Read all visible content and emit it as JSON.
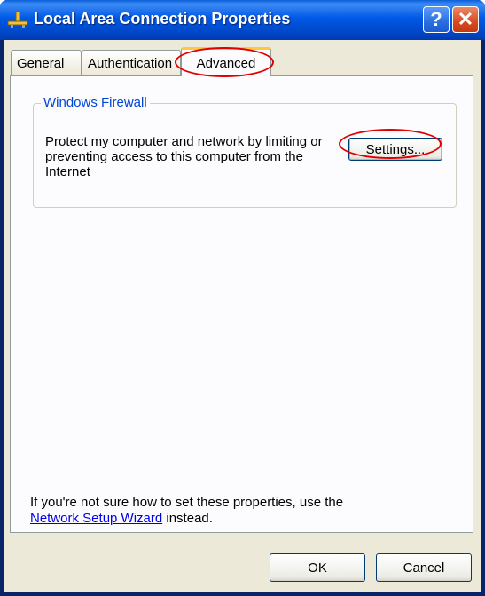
{
  "window": {
    "title": "Local Area Connection Properties",
    "help_glyph": "?",
    "close_glyph": "✕",
    "icon": "network-connection-icon"
  },
  "tabs": [
    {
      "label": "General",
      "selected": false
    },
    {
      "label": "Authentication",
      "selected": false
    },
    {
      "label": "Advanced",
      "selected": true
    }
  ],
  "firewall": {
    "group_label": "Windows Firewall",
    "description": "Protect my computer and network by limiting or preventing access to this computer from the Internet",
    "settings_label_prefix": "",
    "settings_label_underlined": "S",
    "settings_label_rest": "ettings..."
  },
  "footer": {
    "text_before": "If you're not sure how to set these properties, use the ",
    "link_label": "Network Setup Wizard",
    "text_after": " instead."
  },
  "buttons": {
    "ok_label": "OK",
    "cancel_label": "Cancel"
  },
  "colors": {
    "titlebar": "#0058e6",
    "annotation": "#e00000",
    "group_label": "#0046d5"
  }
}
